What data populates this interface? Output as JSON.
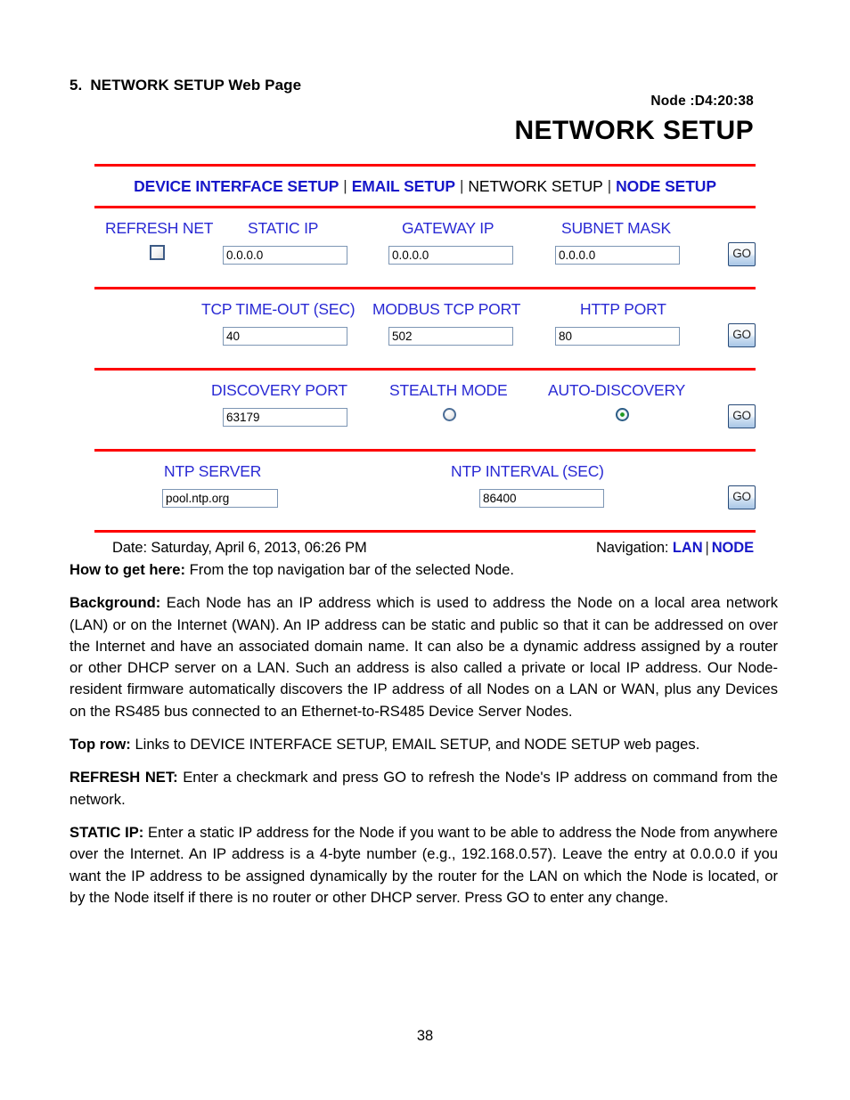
{
  "document": {
    "section_number": "5.",
    "section_heading": "NETWORK SETUP Web Page",
    "page_number": "38"
  },
  "colors": {
    "rule_red": "#fe0000",
    "label_blue": "#2a2ad4",
    "link_blue": "#1717c9",
    "radio_on_green": "#1f9a22",
    "field_border": "#7d96b4"
  },
  "screenshot": {
    "node_label": "Node :D4:20:38",
    "title": "NETWORK SETUP",
    "nav": {
      "separator": "|",
      "items": [
        {
          "label": "DEVICE INTERFACE SETUP",
          "current": false
        },
        {
          "label": "EMAIL SETUP",
          "current": false
        },
        {
          "label": "NETWORK SETUP",
          "current": true
        },
        {
          "label": "NODE SETUP",
          "current": false
        }
      ]
    },
    "rows": [
      {
        "labels": [
          "REFRESH NET",
          "STATIC IP",
          "GATEWAY IP",
          "SUBNET MASK"
        ],
        "checkbox": {
          "name": "REFRESH NET",
          "checked": false
        },
        "fields": [
          {
            "name": "STATIC IP",
            "value": "0.0.0.0"
          },
          {
            "name": "GATEWAY IP",
            "value": "0.0.0.0"
          },
          {
            "name": "SUBNET MASK",
            "value": "0.0.0.0"
          }
        ],
        "go_label": "GO"
      },
      {
        "labels": [
          "TCP TIME-OUT (SEC)",
          "MODBUS TCP PORT",
          "HTTP PORT"
        ],
        "fields": [
          {
            "name": "TCP TIME-OUT (SEC)",
            "value": "40"
          },
          {
            "name": "MODBUS TCP PORT",
            "value": "502"
          },
          {
            "name": "HTTP PORT",
            "value": "80"
          }
        ],
        "go_label": "GO"
      },
      {
        "labels": [
          "DISCOVERY PORT",
          "STEALTH MODE",
          "AUTO-DISCOVERY"
        ],
        "fields": [
          {
            "name": "DISCOVERY PORT",
            "value": "63179"
          }
        ],
        "radios": [
          {
            "name": "STEALTH MODE",
            "selected": false
          },
          {
            "name": "AUTO-DISCOVERY",
            "selected": true
          }
        ],
        "go_label": "GO"
      },
      {
        "labels": [
          "NTP SERVER",
          "NTP INTERVAL (SEC)"
        ],
        "fields": [
          {
            "name": "NTP SERVER",
            "value": "pool.ntp.org"
          },
          {
            "name": "NTP INTERVAL (SEC)",
            "value": "86400"
          }
        ],
        "go_label": "GO"
      }
    ],
    "footer": {
      "date": "Date: Saturday, April 6, 2013, 06:26 PM",
      "nav_prefix": "Navigation:",
      "nav_links": [
        "LAN",
        "NODE"
      ],
      "nav_separator": "|"
    }
  },
  "body": {
    "how_to_get_here_label": "How to get here:",
    "how_to_get_here_text": " From the top navigation bar of the selected Node.",
    "background_label": "Background:",
    "background_text": "  Each Node has an IP address which is used to address the Node on a local area network (LAN) or on the Internet (WAN). An IP address can be static and public so that it can be addressed on over the Internet and have an associated domain name. It can also be a dynamic address assigned by a router or other DHCP server on a LAN. Such an address is also called a private or local IP address. Our Node-resident firmware automatically discovers the IP address of all Nodes on a LAN or WAN, plus any Devices on the RS485 bus connected to an Ethernet-to-RS485 Device Server Nodes.",
    "top_row_label": "Top row:",
    "top_row_text": "  Links to DEVICE INTERFACE SETUP, EMAIL SETUP, and NODE SETUP web pages.",
    "refresh_net_label": "REFRESH NET:",
    "refresh_net_text": " Enter a checkmark and press GO to refresh the Node's IP address on command from the network.",
    "static_ip_label": "STATIC IP:",
    "static_ip_text": " Enter a static IP address for the Node if you want to be able to address the Node from anywhere over the Internet. An IP address is a 4-byte number (e.g., 192.168.0.57). Leave the entry at 0.0.0.0 if you want the IP address to be assigned dynamically by the router for the LAN on which the Node is located, or by the Node itself if there is no router or other DHCP server. Press GO to enter any change."
  }
}
